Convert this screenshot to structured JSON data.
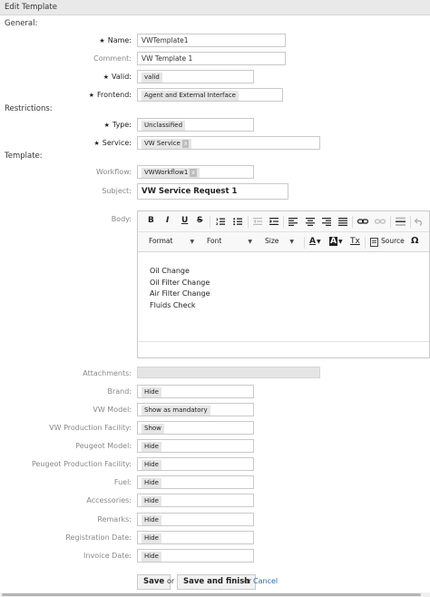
{
  "header": {
    "title": "Edit Template"
  },
  "sections": {
    "general": "General:",
    "restrictions": "Restrictions:",
    "template": "Template:"
  },
  "fields": {
    "name": {
      "label": "Name:",
      "value": "VWTemplate1"
    },
    "comment": {
      "label": "Comment:",
      "value": "VW Template 1"
    },
    "valid": {
      "label": "Valid:",
      "value": "valid"
    },
    "frontend": {
      "label": "Frontend:",
      "value": "Agent and External Interface"
    },
    "type": {
      "label": "Type:",
      "value": "Unclassified"
    },
    "service": {
      "label": "Service:",
      "value": "VW Service",
      "remove": "x"
    },
    "workflow": {
      "label": "Workflow:",
      "value": "VWWorkflow1",
      "remove": "x"
    },
    "subject": {
      "label": "Subject:",
      "value": "VW Service Request 1"
    },
    "body": {
      "label": "Body:"
    },
    "attachments": {
      "label": "Attachments:"
    }
  },
  "star": "★",
  "editor": {
    "toolbar": {
      "bold": "B",
      "italic": "I",
      "underline": "U",
      "strike": "S",
      "format": "Format",
      "font": "Font",
      "size": "Size",
      "text_color": "A",
      "bg_color": "A",
      "clear_format": "Tx",
      "source": "Source",
      "omega": "Ω"
    },
    "content": [
      "Oil Change",
      "Oil Filter Change",
      "Air Filter Change",
      "Fluids Check"
    ]
  },
  "dynamic_fields": [
    {
      "label": "Brand:",
      "value": "Hide"
    },
    {
      "label": "VW Model:",
      "value": "Show as mandatory"
    },
    {
      "label": "VW Production Facility:",
      "value": "Show"
    },
    {
      "label": "Peugeot Model:",
      "value": "Hide"
    },
    {
      "label": "Peugeot Production Facility:",
      "value": "Hide"
    },
    {
      "label": "Fuel:",
      "value": "Hide"
    },
    {
      "label": "Accessories:",
      "value": "Hide"
    },
    {
      "label": "Remarks:",
      "value": "Hide"
    },
    {
      "label": "Registration Date:",
      "value": "Hide"
    },
    {
      "label": "Invoice Date:",
      "value": "Hide"
    }
  ],
  "actions": {
    "save": "Save",
    "or1": "or",
    "save_finish": "Save and finish",
    "or2": "or",
    "cancel": "Cancel"
  }
}
